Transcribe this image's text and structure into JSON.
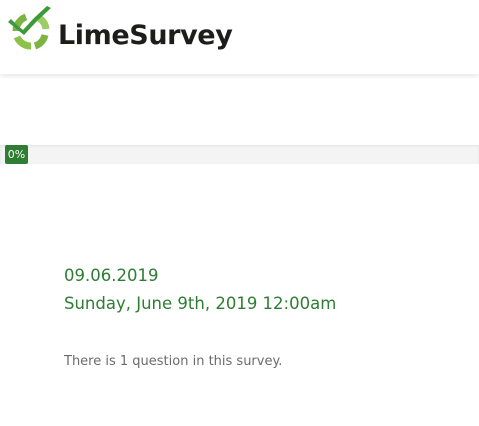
{
  "header": {
    "brand_name": "LimeSurvey",
    "logo_icon": "limesurvey-logo-icon"
  },
  "progress": {
    "label": "0%",
    "value": 0
  },
  "welcome": {
    "date_short": "09.06.2019",
    "date_long": "Sunday, June 9th, 2019 12:00am"
  },
  "survey": {
    "question_count_text": "There is 1 question in this survey."
  },
  "colors": {
    "brand_green": "#2e7d32",
    "logo_green": "#8bc34a",
    "text_muted": "#6b6b6b"
  }
}
